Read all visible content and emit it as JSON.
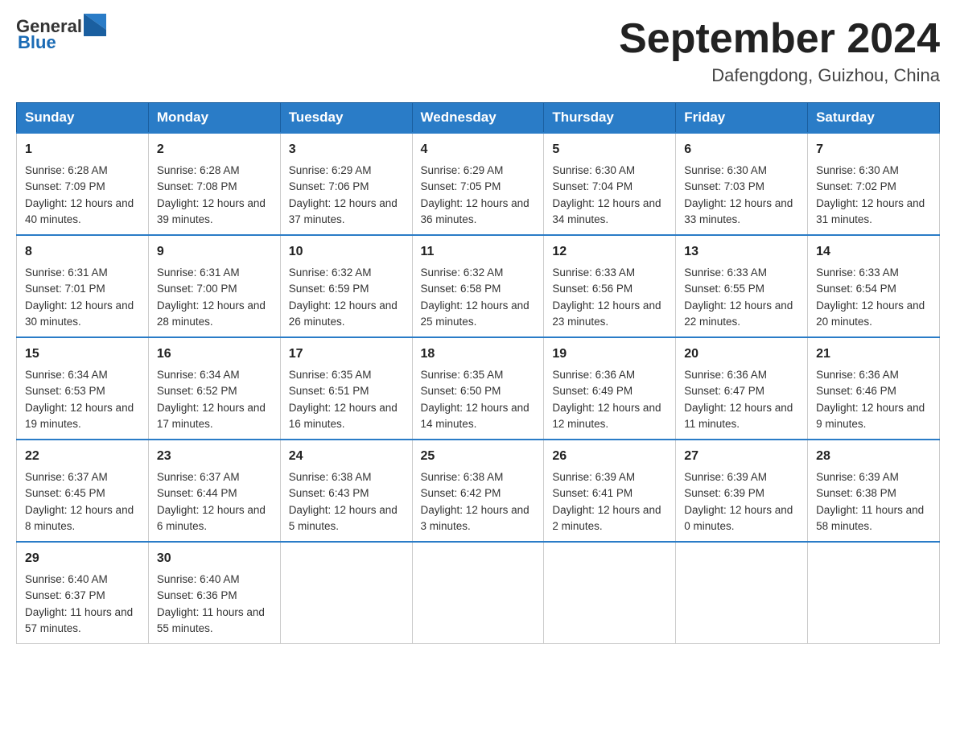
{
  "logo": {
    "general": "General",
    "blue": "Blue"
  },
  "title": "September 2024",
  "location": "Dafengdong, Guizhou, China",
  "days_of_week": [
    "Sunday",
    "Monday",
    "Tuesday",
    "Wednesday",
    "Thursday",
    "Friday",
    "Saturday"
  ],
  "weeks": [
    [
      {
        "day": "1",
        "sunrise": "6:28 AM",
        "sunset": "7:09 PM",
        "daylight": "12 hours and 40 minutes."
      },
      {
        "day": "2",
        "sunrise": "6:28 AM",
        "sunset": "7:08 PM",
        "daylight": "12 hours and 39 minutes."
      },
      {
        "day": "3",
        "sunrise": "6:29 AM",
        "sunset": "7:06 PM",
        "daylight": "12 hours and 37 minutes."
      },
      {
        "day": "4",
        "sunrise": "6:29 AM",
        "sunset": "7:05 PM",
        "daylight": "12 hours and 36 minutes."
      },
      {
        "day": "5",
        "sunrise": "6:30 AM",
        "sunset": "7:04 PM",
        "daylight": "12 hours and 34 minutes."
      },
      {
        "day": "6",
        "sunrise": "6:30 AM",
        "sunset": "7:03 PM",
        "daylight": "12 hours and 33 minutes."
      },
      {
        "day": "7",
        "sunrise": "6:30 AM",
        "sunset": "7:02 PM",
        "daylight": "12 hours and 31 minutes."
      }
    ],
    [
      {
        "day": "8",
        "sunrise": "6:31 AM",
        "sunset": "7:01 PM",
        "daylight": "12 hours and 30 minutes."
      },
      {
        "day": "9",
        "sunrise": "6:31 AM",
        "sunset": "7:00 PM",
        "daylight": "12 hours and 28 minutes."
      },
      {
        "day": "10",
        "sunrise": "6:32 AM",
        "sunset": "6:59 PM",
        "daylight": "12 hours and 26 minutes."
      },
      {
        "day": "11",
        "sunrise": "6:32 AM",
        "sunset": "6:58 PM",
        "daylight": "12 hours and 25 minutes."
      },
      {
        "day": "12",
        "sunrise": "6:33 AM",
        "sunset": "6:56 PM",
        "daylight": "12 hours and 23 minutes."
      },
      {
        "day": "13",
        "sunrise": "6:33 AM",
        "sunset": "6:55 PM",
        "daylight": "12 hours and 22 minutes."
      },
      {
        "day": "14",
        "sunrise": "6:33 AM",
        "sunset": "6:54 PM",
        "daylight": "12 hours and 20 minutes."
      }
    ],
    [
      {
        "day": "15",
        "sunrise": "6:34 AM",
        "sunset": "6:53 PM",
        "daylight": "12 hours and 19 minutes."
      },
      {
        "day": "16",
        "sunrise": "6:34 AM",
        "sunset": "6:52 PM",
        "daylight": "12 hours and 17 minutes."
      },
      {
        "day": "17",
        "sunrise": "6:35 AM",
        "sunset": "6:51 PM",
        "daylight": "12 hours and 16 minutes."
      },
      {
        "day": "18",
        "sunrise": "6:35 AM",
        "sunset": "6:50 PM",
        "daylight": "12 hours and 14 minutes."
      },
      {
        "day": "19",
        "sunrise": "6:36 AM",
        "sunset": "6:49 PM",
        "daylight": "12 hours and 12 minutes."
      },
      {
        "day": "20",
        "sunrise": "6:36 AM",
        "sunset": "6:47 PM",
        "daylight": "12 hours and 11 minutes."
      },
      {
        "day": "21",
        "sunrise": "6:36 AM",
        "sunset": "6:46 PM",
        "daylight": "12 hours and 9 minutes."
      }
    ],
    [
      {
        "day": "22",
        "sunrise": "6:37 AM",
        "sunset": "6:45 PM",
        "daylight": "12 hours and 8 minutes."
      },
      {
        "day": "23",
        "sunrise": "6:37 AM",
        "sunset": "6:44 PM",
        "daylight": "12 hours and 6 minutes."
      },
      {
        "day": "24",
        "sunrise": "6:38 AM",
        "sunset": "6:43 PM",
        "daylight": "12 hours and 5 minutes."
      },
      {
        "day": "25",
        "sunrise": "6:38 AM",
        "sunset": "6:42 PM",
        "daylight": "12 hours and 3 minutes."
      },
      {
        "day": "26",
        "sunrise": "6:39 AM",
        "sunset": "6:41 PM",
        "daylight": "12 hours and 2 minutes."
      },
      {
        "day": "27",
        "sunrise": "6:39 AM",
        "sunset": "6:39 PM",
        "daylight": "12 hours and 0 minutes."
      },
      {
        "day": "28",
        "sunrise": "6:39 AM",
        "sunset": "6:38 PM",
        "daylight": "11 hours and 58 minutes."
      }
    ],
    [
      {
        "day": "29",
        "sunrise": "6:40 AM",
        "sunset": "6:37 PM",
        "daylight": "11 hours and 57 minutes."
      },
      {
        "day": "30",
        "sunrise": "6:40 AM",
        "sunset": "6:36 PM",
        "daylight": "11 hours and 55 minutes."
      },
      null,
      null,
      null,
      null,
      null
    ]
  ]
}
